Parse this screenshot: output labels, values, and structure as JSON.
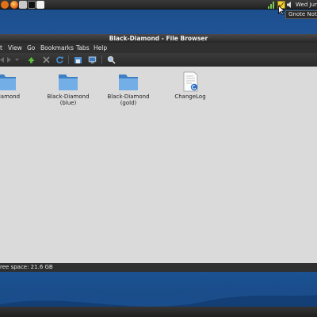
{
  "panel": {
    "clock": "Wed Jun",
    "tooltip": "Gnote Notes",
    "launchers": [
      "ubuntu-menu-icon",
      "firefox-icon",
      "files-icon",
      "terminal-icon",
      "text-editor-icon"
    ],
    "tray": [
      "wifi-icon",
      "gnote-icon",
      "volume-icon"
    ]
  },
  "window": {
    "title": "Black-Diamond - File Browser",
    "menu": [
      "t",
      "View",
      "Go",
      "Bookmarks",
      "Tabs",
      "Help"
    ],
    "status": "ree space: 21.6 GB"
  },
  "files": [
    {
      "name": "-Diamond",
      "type": "folder",
      "color": "#5d9ad6"
    },
    {
      "name": "Black-Diamond\n(blue)",
      "type": "folder",
      "color": "#5d9ad6"
    },
    {
      "name": "Black-Diamond\n(gold)",
      "type": "folder",
      "color": "#5d9ad6"
    },
    {
      "name": "ChangeLog",
      "type": "text-file",
      "color": "#ffffff"
    }
  ]
}
